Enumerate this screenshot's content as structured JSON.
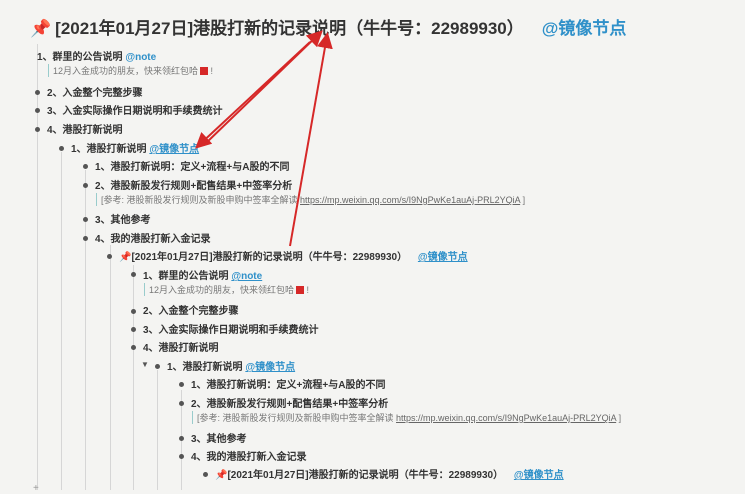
{
  "title": {
    "text": "[2021年01月27日]港股打新的记录说明（牛牛号：22989930）",
    "link": "@镜像节点"
  },
  "level1": {
    "item1": "1、群里的公告说明",
    "item1_link": "@note",
    "item1_note": "12月入金成功的朋友，快来领红包哈",
    "item2": "2、入金整个完整步骤",
    "item3": "3、入金实际操作日期说明和手续费统计",
    "item4": "4、港股打新说明"
  },
  "level2": {
    "item1": "1、港股打新说明",
    "item1_link": "@镜像节点"
  },
  "level3": {
    "item1": "1、港股打新说明：定义+流程+与A股的不同",
    "item2": "2、港股新股发行规则+配售结果+中签率分析",
    "item2_note_prefix": "[参考: 港股新股发行规则及新股申购中签率全解读",
    "item2_note_url": "https://mp.weixin.qq.com/s/I9NgPwKe1auAj-PRL2YQiA",
    "item2_note_suffix": "]",
    "item3": "3、其他参考",
    "item4": "4、我的港股打新入金记录"
  },
  "mirror1": {
    "text": "[2021年01月27日]港股打新的记录说明（牛牛号：22989930）",
    "link": "@镜像节点",
    "item1": "1、群里的公告说明",
    "item1_link": "@note",
    "item1_note": "12月入金成功的朋友，快来领红包哈",
    "item2": "2、入金整个完整步骤",
    "item3": "3、入金实际操作日期说明和手续费统计",
    "item4": "4、港股打新说明",
    "sub1": "1、港股打新说明",
    "sub1_link": "@镜像节点",
    "d1": "1、港股打新说明：定义+流程+与A股的不同",
    "d2": "2、港股新股发行规则+配售结果+中签率分析",
    "d2_note_prefix": "[参考: 港股新股发行规则及新股申购中签率全解读",
    "d2_note_url": "https://mp.weixin.qq.com/s/I9NgPwKe1auAj-PRL2YQiA",
    "d2_note_suffix": "]",
    "d3": "3、其他参考",
    "d4": "4、我的港股打新入金记录"
  },
  "mirror2": {
    "text": "[2021年01月27日]港股打新的记录说明（牛牛号：22989930）",
    "link": "@镜像节点"
  },
  "colors": {
    "link": "#2f90c9",
    "arrow": "#d62828",
    "background": "#f4f4f2"
  }
}
